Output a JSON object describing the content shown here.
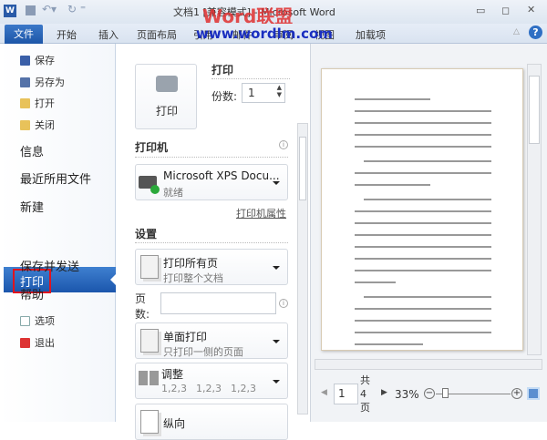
{
  "title_bar": {
    "title": "文档1 [兼容模式] - Microsoft Word",
    "watermark_logo": "Word联盟",
    "watermark_url": "www.wordlm.com"
  },
  "ribbon": {
    "tabs": [
      "文件",
      "开始",
      "插入",
      "页面布局",
      "引用",
      "邮件",
      "审阅",
      "视图",
      "加载项"
    ]
  },
  "nav": {
    "small_items": [
      "保存",
      "另存为",
      "打开",
      "关闭"
    ],
    "items": [
      "信息",
      "最近所用文件",
      "新建",
      "打印",
      "保存并发送",
      "帮助"
    ],
    "bottom_items": [
      "选项",
      "退出"
    ]
  },
  "print": {
    "section": "打印",
    "button": "打印",
    "copies_label": "份数:",
    "copies": "1"
  },
  "printer": {
    "section": "打印机",
    "name": "Microsoft XPS Docu...",
    "status": "就绪",
    "properties_link": "打印机属性"
  },
  "settings": {
    "section": "设置",
    "range": {
      "title": "打印所有页",
      "desc": "打印整个文档"
    },
    "pages_label": "页数:",
    "pages_value": "",
    "sides": {
      "title": "单面打印",
      "desc": "只打印一侧的页面"
    },
    "collate": {
      "title": "调整",
      "desc": [
        "1,2,3",
        "1,2,3",
        "1,2,3"
      ]
    },
    "orientation": {
      "title": "纵向"
    }
  },
  "preview": {
    "page": "1",
    "total_prefix": "共",
    "total": "4",
    "total_suffix": "页",
    "zoom": "33%",
    "zoom_percent": 33
  }
}
